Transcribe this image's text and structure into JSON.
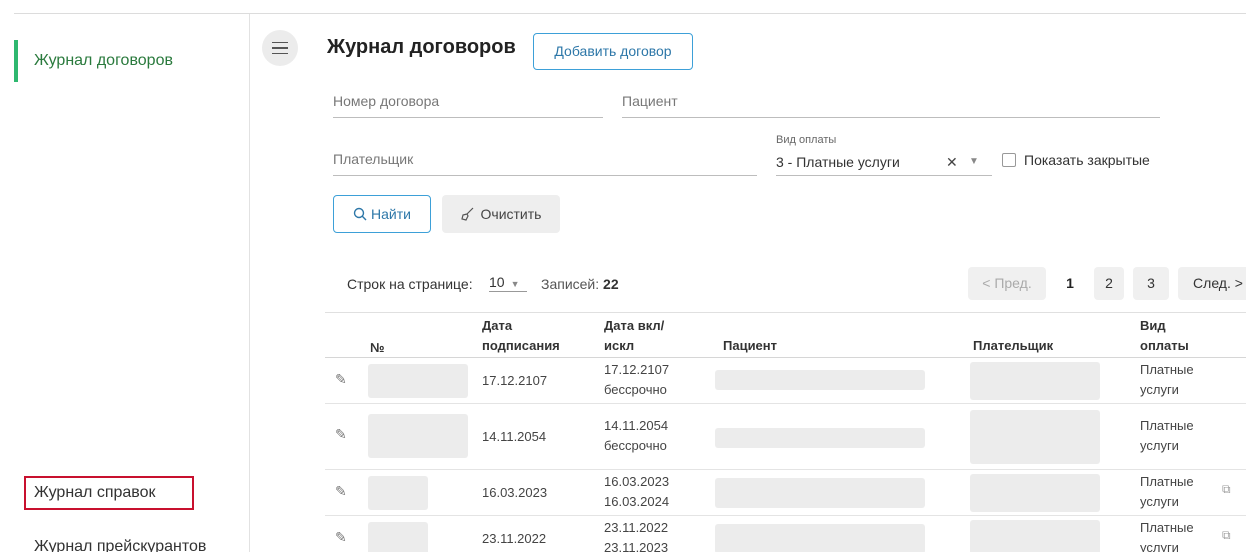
{
  "sidebar": {
    "items": [
      {
        "label": "Журнал договоров"
      },
      {
        "label": "Журнал справок"
      },
      {
        "label": "Журнал прейскурантов"
      }
    ]
  },
  "header": {
    "title": "Журнал договоров",
    "add_button": "Добавить договор"
  },
  "filters": {
    "contract_number_placeholder": "Номер договора",
    "patient_placeholder": "Пациент",
    "payer_placeholder": "Плательщик",
    "payment_type_label": "Вид оплаты",
    "payment_type_value": "3 - Платные услуги",
    "show_closed_label": "Показать закрытые",
    "find_button": "Найти",
    "clear_button": "Очистить"
  },
  "pagination": {
    "rows_per_page_label": "Строк на странице:",
    "rows_per_page_value": "10",
    "records_label": "Записей:",
    "records_count": "22",
    "prev_label": "< Пред.",
    "pages": [
      "1",
      "2",
      "3"
    ],
    "next_label": "След. >"
  },
  "table": {
    "columns": {
      "number": "№",
      "signed_date_1": "Дата",
      "signed_date_2": "подписания",
      "incl_date_1": "Дата вкл/",
      "incl_date_2": "искл",
      "patient": "Пациент",
      "payer": "Плательщик",
      "paytype_1": "Вид",
      "paytype_2": "оплаты"
    },
    "rows": [
      {
        "signed": "17.12.2107",
        "incl": "17.12.2107",
        "excl": "бессрочно",
        "pay1": "Платные",
        "pay2": "услуги"
      },
      {
        "signed": "14.11.2054",
        "incl": "14.11.2054",
        "excl": "бессрочно",
        "pay1": "Платные",
        "pay2": "услуги"
      },
      {
        "signed": "16.03.2023",
        "incl": "16.03.2023",
        "excl": "16.03.2024",
        "pay1": "Платные",
        "pay2": "услуги"
      },
      {
        "signed": "23.11.2022",
        "incl": "23.11.2022",
        "excl": "23.11.2023",
        "pay1": "Платные",
        "pay2": "услуги"
      }
    ]
  }
}
